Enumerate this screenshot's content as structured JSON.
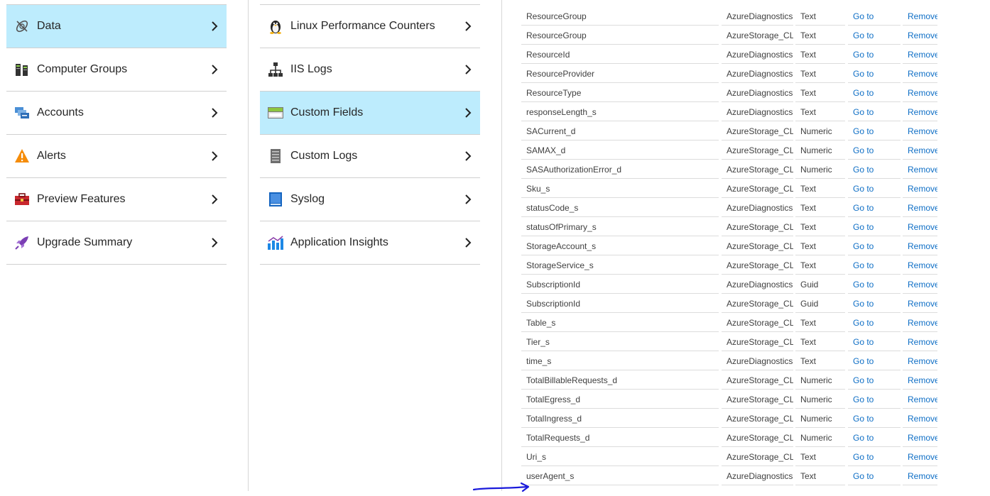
{
  "left_menu": {
    "items": [
      {
        "label": "Data",
        "icon": "data-icon",
        "selected": true
      },
      {
        "label": "Computer Groups",
        "icon": "computer-groups-icon"
      },
      {
        "label": "Accounts",
        "icon": "accounts-icon"
      },
      {
        "label": "Alerts",
        "icon": "alert-icon"
      },
      {
        "label": "Preview Features",
        "icon": "toolbox-icon"
      },
      {
        "label": "Upgrade Summary",
        "icon": "rocket-icon"
      }
    ]
  },
  "data_menu": {
    "items": [
      {
        "label": "Linux Performance Counters",
        "icon": "linux-penguin-icon"
      },
      {
        "label": "IIS Logs",
        "icon": "network-icon"
      },
      {
        "label": "Custom Fields",
        "icon": "custom-fields-icon",
        "selected": true
      },
      {
        "label": "Custom Logs",
        "icon": "custom-logs-icon"
      },
      {
        "label": "Syslog",
        "icon": "syslog-book-icon"
      },
      {
        "label": "Application Insights",
        "icon": "app-insights-chart-icon"
      }
    ]
  },
  "fields_table": {
    "link_go": "Go to",
    "link_remove": "Remove",
    "rows": [
      {
        "name": "ResourceGroup",
        "type": "AzureDiagnostics",
        "datatype": "Text"
      },
      {
        "name": "ResourceGroup",
        "type": "AzureStorage_CL",
        "datatype": "Text"
      },
      {
        "name": "ResourceId",
        "type": "AzureDiagnostics",
        "datatype": "Text"
      },
      {
        "name": "ResourceProvider",
        "type": "AzureDiagnostics",
        "datatype": "Text"
      },
      {
        "name": "ResourceType",
        "type": "AzureDiagnostics",
        "datatype": "Text"
      },
      {
        "name": "responseLength_s",
        "type": "AzureDiagnostics",
        "datatype": "Text"
      },
      {
        "name": "SACurrent_d",
        "type": "AzureStorage_CL",
        "datatype": "Numeric"
      },
      {
        "name": "SAMAX_d",
        "type": "AzureStorage_CL",
        "datatype": "Numeric"
      },
      {
        "name": "SASAuthorizationError_d",
        "type": "AzureStorage_CL",
        "datatype": "Numeric"
      },
      {
        "name": "Sku_s",
        "type": "AzureStorage_CL",
        "datatype": "Text"
      },
      {
        "name": "statusCode_s",
        "type": "AzureDiagnostics",
        "datatype": "Text"
      },
      {
        "name": "statusOfPrimary_s",
        "type": "AzureStorage_CL",
        "datatype": "Text"
      },
      {
        "name": "StorageAccount_s",
        "type": "AzureStorage_CL",
        "datatype": "Text"
      },
      {
        "name": "StorageService_s",
        "type": "AzureStorage_CL",
        "datatype": "Text"
      },
      {
        "name": "SubscriptionId",
        "type": "AzureDiagnostics",
        "datatype": "Guid"
      },
      {
        "name": "SubscriptionId",
        "type": "AzureStorage_CL",
        "datatype": "Guid"
      },
      {
        "name": "Table_s",
        "type": "AzureStorage_CL",
        "datatype": "Text"
      },
      {
        "name": "Tier_s",
        "type": "AzureStorage_CL",
        "datatype": "Text"
      },
      {
        "name": "time_s",
        "type": "AzureDiagnostics",
        "datatype": "Text"
      },
      {
        "name": "TotalBillableRequests_d",
        "type": "AzureStorage_CL",
        "datatype": "Numeric"
      },
      {
        "name": "TotalEgress_d",
        "type": "AzureStorage_CL",
        "datatype": "Numeric"
      },
      {
        "name": "TotalIngress_d",
        "type": "AzureStorage_CL",
        "datatype": "Numeric"
      },
      {
        "name": "TotalRequests_d",
        "type": "AzureStorage_CL",
        "datatype": "Numeric"
      },
      {
        "name": "Uri_s",
        "type": "AzureStorage_CL",
        "datatype": "Text"
      },
      {
        "name": "userAgent_s",
        "type": "AzureDiagnostics",
        "datatype": "Text"
      }
    ]
  },
  "colors": {
    "selected_bg": "#bdecfd",
    "link": "#0f6fc6",
    "annotation_arrow": "#1a1adb"
  }
}
